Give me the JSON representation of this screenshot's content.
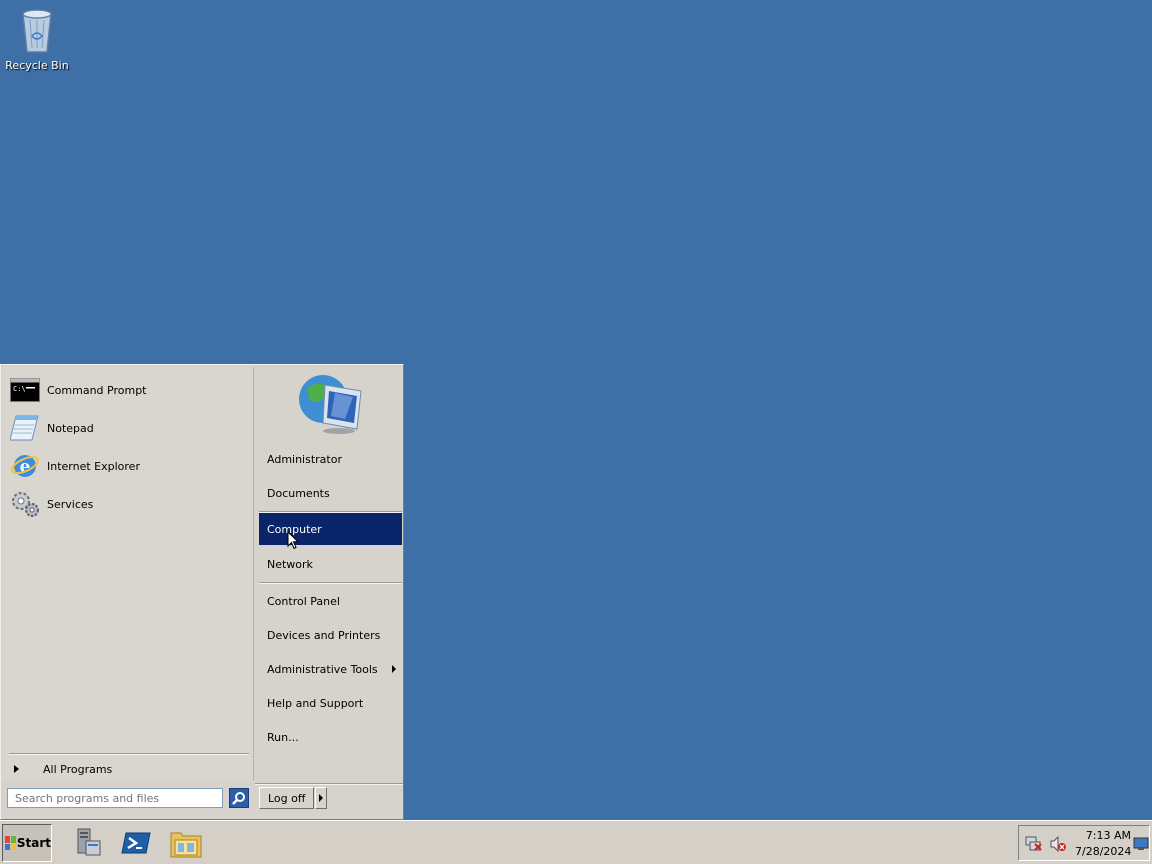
{
  "desktop": {
    "icons": [
      {
        "label": "Recycle Bin",
        "icon": "recycle-bin-icon"
      }
    ]
  },
  "start_menu": {
    "pinned": [
      {
        "label": "Command Prompt",
        "icon": "command-prompt-icon"
      },
      {
        "label": "Notepad",
        "icon": "notepad-icon"
      },
      {
        "label": "Internet Explorer",
        "icon": "internet-explorer-icon"
      },
      {
        "label": "Services",
        "icon": "services-icon"
      }
    ],
    "all_programs": "All Programs",
    "search": {
      "placeholder": "Search programs and files",
      "value": ""
    },
    "right_items": [
      {
        "label": "Administrator"
      },
      {
        "label": "Documents"
      },
      {
        "label": "Computer",
        "selected": true
      },
      {
        "label": "Network"
      },
      {
        "label": "Control Panel"
      },
      {
        "label": "Devices and Printers"
      },
      {
        "label": "Administrative Tools",
        "submenu": true
      },
      {
        "label": "Help and Support"
      },
      {
        "label": "Run..."
      }
    ],
    "logoff_label": "Log off"
  },
  "taskbar": {
    "start_label": "Start",
    "pinned": [
      {
        "name": "server-manager-icon"
      },
      {
        "name": "powershell-icon"
      },
      {
        "name": "windows-explorer-icon"
      }
    ],
    "tray": {
      "time": "7:13 AM",
      "date": "7/28/2024"
    }
  },
  "colors": {
    "desktop": "#3e6fa7",
    "selection": "#0a246a",
    "panel": "#d6d3cc"
  }
}
